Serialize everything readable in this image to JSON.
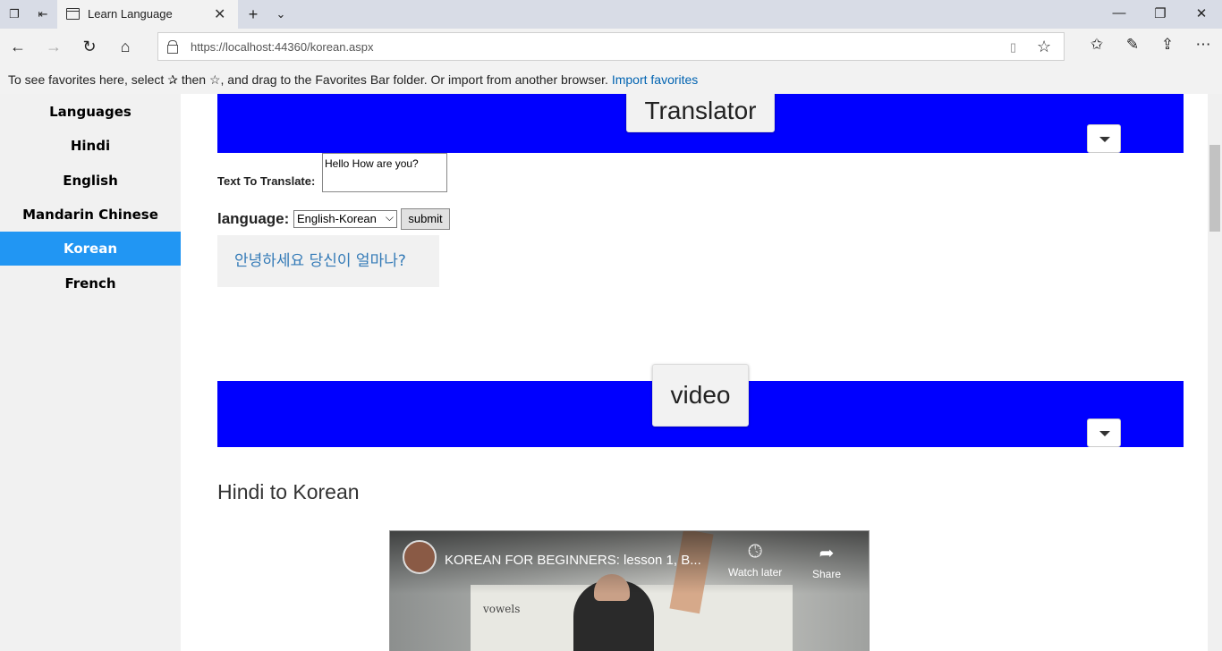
{
  "browser": {
    "tab_title": "Learn Language",
    "url": "https://localhost:44360/korean.aspx",
    "favorites_message": "To see favorites here, select ✰ then ☆, and drag to the Favorites Bar folder. Or import from another browser.",
    "import_favorites": "Import favorites"
  },
  "sidebar": {
    "items": [
      {
        "label": "Languages"
      },
      {
        "label": "Hindi"
      },
      {
        "label": "English"
      },
      {
        "label": "Mandarin Chinese"
      },
      {
        "label": "Korean",
        "active": true
      },
      {
        "label": "French"
      }
    ],
    "active_color": "#2196f3"
  },
  "translator": {
    "heading": "Translator",
    "text_label": "Text To Translate:",
    "text_value": "Hello How are you?",
    "language_label": "language:",
    "language_selected": "English-Korean",
    "submit_label": "submit",
    "result": "안녕하세요 당신이 얼마나?",
    "band_color": "#0000ff"
  },
  "video_section": {
    "heading": "video",
    "subheading": "Hindi to Korean",
    "video_title": "KOREAN FOR BEGINNERS: lesson 1, B...",
    "watch_later": "Watch later",
    "share": "Share",
    "board_text": "vowels"
  }
}
